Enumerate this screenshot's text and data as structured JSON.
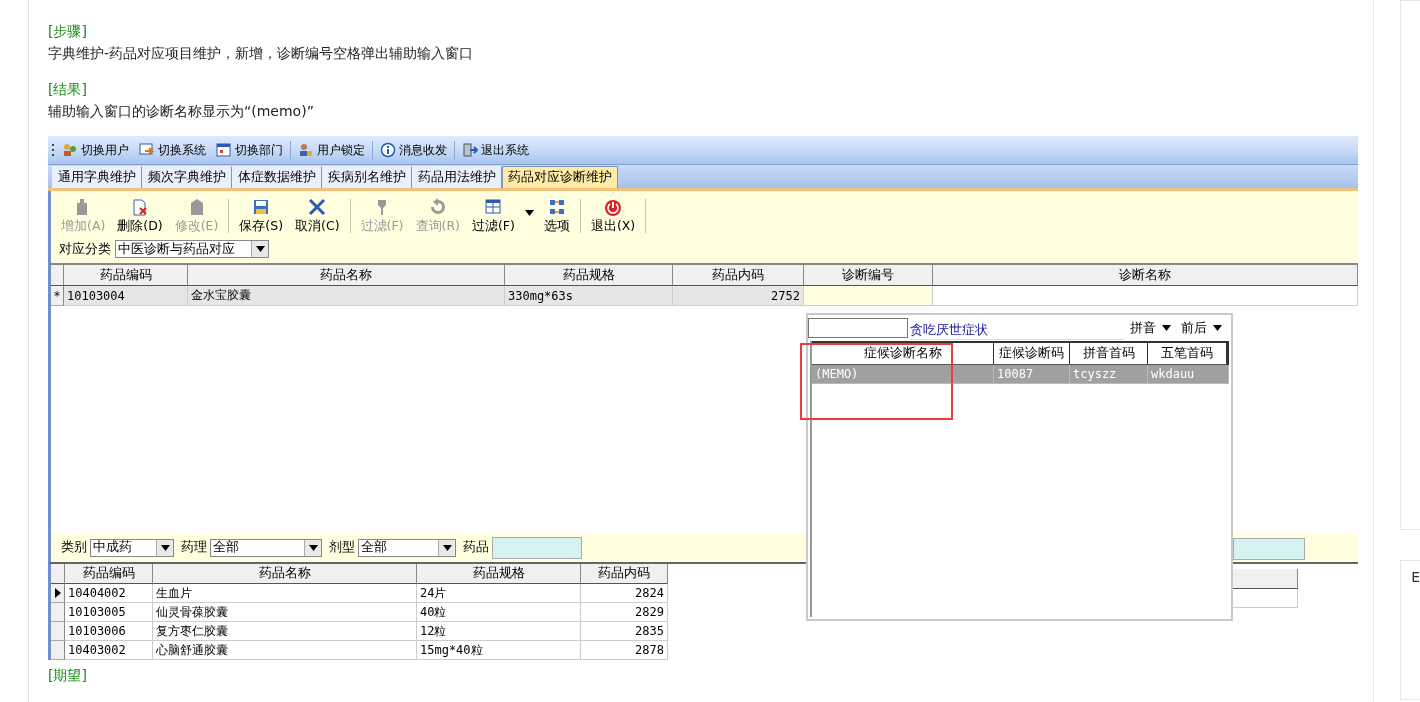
{
  "doc": {
    "sections": [
      {
        "heading": "[步骤]",
        "text": "字典维护-药品对应项目维护，新增，诊断编号空格弹出辅助输入窗口"
      },
      {
        "heading": "[结果]",
        "text": "辅助输入窗口的诊断名称显示为“(memo)”"
      }
    ],
    "next_heading": "[期望]"
  },
  "app": {
    "toolbar": [
      {
        "label": "切换用户"
      },
      {
        "label": "切换系统"
      },
      {
        "label": "切换部门"
      },
      {
        "label": "用户锁定"
      },
      {
        "label": "消息收发"
      },
      {
        "label": "退出系统"
      }
    ],
    "tabs": [
      {
        "label": "通用字典维护",
        "selected": false
      },
      {
        "label": "频次字典维护",
        "selected": false
      },
      {
        "label": "体症数据维护",
        "selected": false
      },
      {
        "label": "疾病别名维护",
        "selected": false
      },
      {
        "label": "药品用法维护",
        "selected": false
      },
      {
        "label": "药品对应诊断维护",
        "selected": true
      }
    ],
    "actions": [
      {
        "label": "增加(A)",
        "disabled": true
      },
      {
        "label": "删除(D)",
        "disabled": false
      },
      {
        "label": "修改(E)",
        "disabled": true
      },
      {
        "label": "保存(S)",
        "disabled": false
      },
      {
        "label": "取消(C)",
        "disabled": false
      },
      {
        "label": "过滤(F)",
        "disabled": true
      },
      {
        "label": "查询(R)",
        "disabled": true
      },
      {
        "label": "过滤(F)",
        "disabled": false
      },
      {
        "label": "选项",
        "disabled": false
      },
      {
        "label": "退出(X)",
        "disabled": false
      }
    ],
    "category": {
      "label": "对应分类",
      "value": "中医诊断与药品对应"
    },
    "grid": {
      "columns": [
        "药品编码",
        "药品名称",
        "药品规格",
        "药品内码",
        "诊断编号",
        "诊断名称"
      ],
      "rows": [
        {
          "marker": "*",
          "cells": [
            "10103004",
            "金水宝胶囊",
            "330mg*63s",
            "2752",
            "",
            ""
          ]
        }
      ]
    },
    "filters": [
      {
        "label": "类别",
        "value": "中成药"
      },
      {
        "label": "药理",
        "value": "全部"
      },
      {
        "label": "剂型",
        "value": "全部"
      }
    ],
    "drug_field": {
      "label": "药品"
    },
    "drug_grid": {
      "columns": [
        "药品编码",
        "药品名称",
        "药品规格",
        "药品内码"
      ],
      "rows": [
        {
          "current": true,
          "cells": [
            "10404002",
            "生血片",
            "24片",
            "2824"
          ]
        },
        {
          "current": false,
          "cells": [
            "10103005",
            "仙灵骨葆胶囊",
            "40粒",
            "2829"
          ]
        },
        {
          "current": false,
          "cells": [
            "10103006",
            "复方枣仁胶囊",
            "12粒",
            "2835"
          ]
        },
        {
          "current": false,
          "cells": [
            "10403002",
            "心脑舒通胶囊",
            "15mg*40粒",
            "2878"
          ]
        }
      ]
    },
    "popup": {
      "hint": "贪吃厌世症状",
      "modes": [
        "拼音",
        "前后"
      ],
      "columns": [
        "症候诊断名称",
        "症候诊断码",
        "拼音首码",
        "五笔首码"
      ],
      "rows": [
        {
          "selected": true,
          "cells": [
            "(MEMO)",
            "10087",
            "tcyszz",
            "wkdauu"
          ]
        }
      ]
    }
  },
  "side_panel": {
    "card_text": "E"
  }
}
